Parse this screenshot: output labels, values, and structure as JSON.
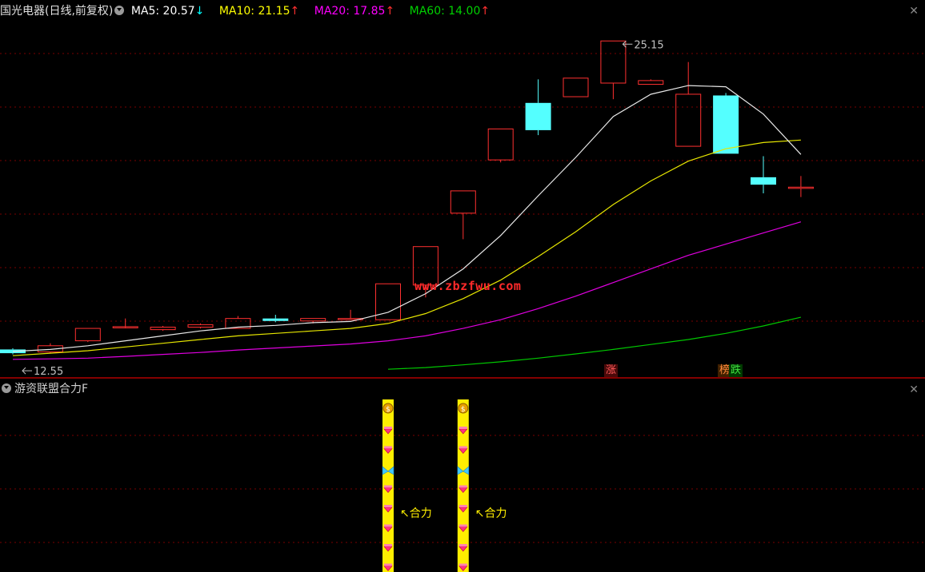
{
  "header": {
    "title": "国光电器(日线,前复权)",
    "ma5": {
      "label": "MA5: 20.57",
      "arrow": "↓",
      "color": "#ffffff",
      "arrow_color": "#00ffff",
      "value": 20.57
    },
    "ma10": {
      "label": "MA10: 21.15",
      "arrow": "↑",
      "color": "#ffff00",
      "arrow_color": "#ff3030",
      "value": 21.15
    },
    "ma20": {
      "label": "MA20: 17.85",
      "arrow": "↑",
      "color": "#ff00ff",
      "arrow_color": "#ff3030",
      "value": 17.85
    },
    "ma60": {
      "label": "MA60: 14.00",
      "arrow": "↑",
      "color": "#00d000",
      "arrow_color": "#ff3030",
      "value": 14.0
    },
    "close": "✕"
  },
  "watermark": "www.zbzfwu.com",
  "tags": {
    "zhang": "涨",
    "bang": "榜",
    "die": "跌"
  },
  "indicator": {
    "title": "游资联盟合力F",
    "signal_label": "↖合力",
    "close": "✕",
    "signals_at_candle_index": [
      10,
      12
    ]
  },
  "chart_data": {
    "type": "candlestick",
    "title": "国光电器(日线,前复权)",
    "candles": [
      {
        "open": 12.7,
        "close": 12.55,
        "high": 12.75,
        "low": 12.5
      },
      {
        "open": 12.6,
        "close": 12.85,
        "high": 12.95,
        "low": 12.55
      },
      {
        "open": 13.05,
        "close": 13.55,
        "high": 13.55,
        "low": 13.0
      },
      {
        "open": 13.6,
        "close": 13.62,
        "high": 13.95,
        "low": 13.55
      },
      {
        "open": 13.5,
        "close": 13.6,
        "high": 13.65,
        "low": 13.45
      },
      {
        "open": 13.6,
        "close": 13.7,
        "high": 13.75,
        "low": 13.55
      },
      {
        "open": 13.55,
        "close": 13.95,
        "high": 14.05,
        "low": 13.55
      },
      {
        "open": 13.95,
        "close": 13.85,
        "high": 14.1,
        "low": 13.8
      },
      {
        "open": 13.85,
        "close": 13.95,
        "high": 13.95,
        "low": 13.75
      },
      {
        "open": 13.9,
        "close": 13.95,
        "high": 14.3,
        "low": 13.9
      },
      {
        "open": 13.9,
        "close": 15.35,
        "high": 15.35,
        "low": 13.9
      },
      {
        "open": 15.3,
        "close": 16.85,
        "high": 16.85,
        "low": 14.8
      },
      {
        "open": 18.2,
        "close": 19.1,
        "high": 19.1,
        "low": 17.15
      },
      {
        "open": 20.35,
        "close": 21.6,
        "high": 21.6,
        "low": 20.25
      },
      {
        "open": 22.65,
        "close": 21.55,
        "high": 23.6,
        "low": 21.35
      },
      {
        "open": 22.9,
        "close": 23.65,
        "high": 23.65,
        "low": 22.9
      },
      {
        "open": 23.45,
        "close": 25.15,
        "high": 25.15,
        "low": 22.8
      },
      {
        "open": 23.4,
        "close": 23.55,
        "high": 23.6,
        "low": 23.4
      },
      {
        "open": 20.9,
        "close": 23.0,
        "high": 24.3,
        "low": 20.9
      },
      {
        "open": 22.95,
        "close": 20.6,
        "high": 23.05,
        "low": 20.6
      },
      {
        "open": 19.65,
        "close": 19.35,
        "high": 20.5,
        "low": 19.0
      },
      {
        "open": 19.2,
        "close": 19.25,
        "high": 19.7,
        "low": 18.85
      }
    ],
    "ma5": [
      12.62,
      12.7,
      12.85,
      13.05,
      13.25,
      13.45,
      13.6,
      13.67,
      13.78,
      13.83,
      14.2,
      14.95,
      15.95,
      17.3,
      18.9,
      20.45,
      22.1,
      23.0,
      23.35,
      23.3,
      22.2,
      20.57
    ],
    "ma10": [
      12.45,
      12.55,
      12.65,
      12.8,
      12.95,
      13.1,
      13.25,
      13.35,
      13.45,
      13.55,
      13.75,
      14.15,
      14.75,
      15.5,
      16.45,
      17.45,
      18.55,
      19.5,
      20.3,
      20.8,
      21.05,
      21.15
    ],
    "ma20": [
      12.3,
      12.32,
      12.35,
      12.42,
      12.5,
      12.58,
      12.68,
      12.76,
      12.84,
      12.92,
      13.05,
      13.25,
      13.55,
      13.9,
      14.35,
      14.85,
      15.4,
      15.95,
      16.5,
      16.95,
      17.4,
      17.85
    ],
    "ma60": [
      null,
      null,
      null,
      null,
      null,
      null,
      null,
      null,
      null,
      null,
      11.9,
      11.97,
      12.08,
      12.2,
      12.35,
      12.52,
      12.7,
      12.9,
      13.1,
      13.35,
      13.65,
      14.0
    ],
    "annotations": [
      {
        "candle_index": 16,
        "price": 25.15,
        "label": "25.15"
      },
      {
        "candle_index": 0,
        "price": 12.55,
        "label": "12.55"
      }
    ],
    "ylim": [
      11.65,
      25.9
    ],
    "grid": true
  }
}
